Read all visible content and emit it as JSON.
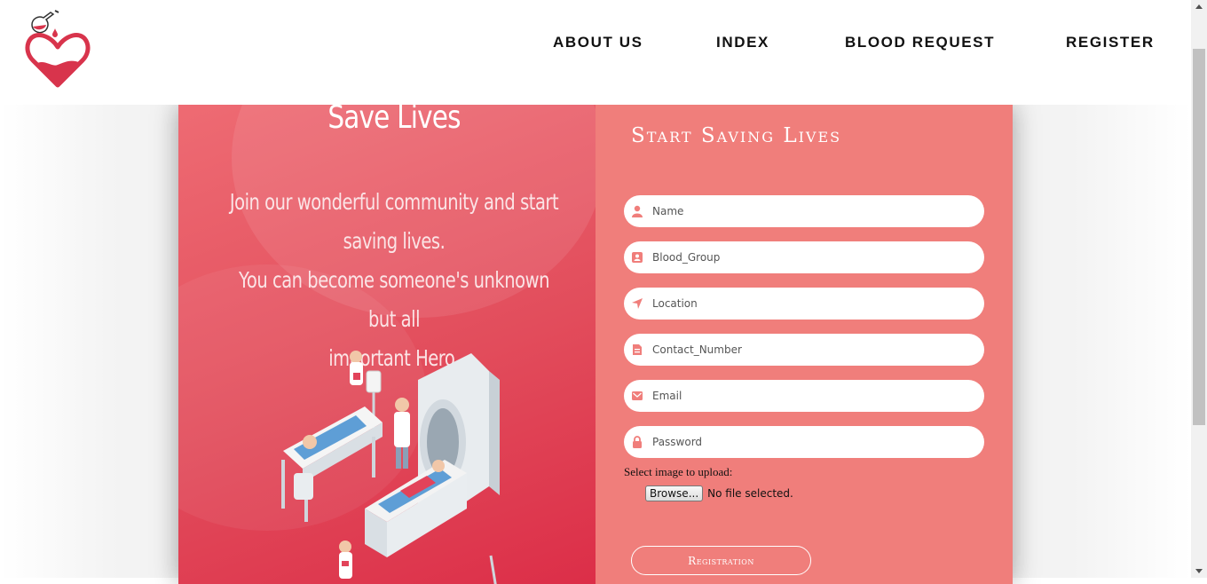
{
  "header": {
    "logo_icon": "heart-blood-logo-icon",
    "nav": [
      {
        "label": "ABOUT US"
      },
      {
        "label": "INDEX"
      },
      {
        "label": "BLOOD REQUEST"
      },
      {
        "label": "REGISTER"
      }
    ]
  },
  "hero": {
    "title": "Save Lives",
    "text_lines": [
      "Join our wonderful community and start saving lives.",
      "You can become someone's unknown but all",
      "important Hero."
    ],
    "illustration": "hospital-mri-illustration"
  },
  "form": {
    "title": "Start Saving Lives",
    "fields": [
      {
        "placeholder": "Name",
        "icon": "user-icon"
      },
      {
        "placeholder": "Blood_Group",
        "icon": "contact-book-icon"
      },
      {
        "placeholder": "Location",
        "icon": "location-arrow-icon"
      },
      {
        "placeholder": "Contact_Number",
        "icon": "document-icon"
      },
      {
        "placeholder": "Email",
        "icon": "envelope-icon"
      },
      {
        "placeholder": "Password",
        "icon": "lock-icon"
      }
    ],
    "upload_label": "Select image to upload:",
    "browse_label": "Browse...",
    "file_status": "No file selected.",
    "submit_label": "Registration"
  },
  "colors": {
    "accent": "#f07e7b",
    "hero_red": "#e24d5c",
    "icon": "#f07e7b"
  }
}
